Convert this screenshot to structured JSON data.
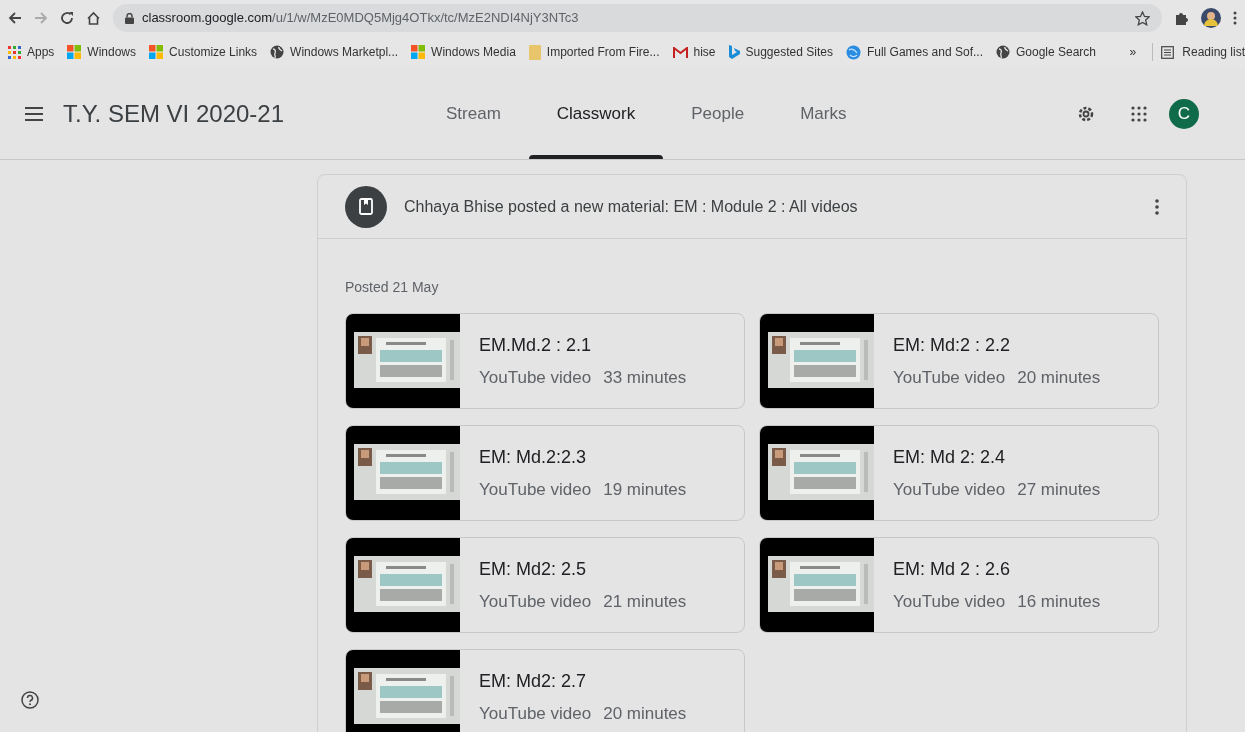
{
  "browser": {
    "url_host": "classroom.google.com",
    "url_path": "/u/1/w/MzE0MDQ5Mjg4OTkx/tc/MzE2NDI4NjY3NTc3",
    "bookmarks": [
      {
        "label": "Apps",
        "kind": "apps"
      },
      {
        "label": "Windows",
        "kind": "ms"
      },
      {
        "label": "Customize Links",
        "kind": "ms"
      },
      {
        "label": "Windows Marketpl...",
        "kind": "globe"
      },
      {
        "label": "Windows Media",
        "kind": "ms"
      },
      {
        "label": "Imported From Fire...",
        "kind": "folder"
      },
      {
        "label": "hise",
        "kind": "mail"
      },
      {
        "label": "Suggested Sites",
        "kind": "bing"
      },
      {
        "label": "Full Games and Sof...",
        "kind": "ie"
      },
      {
        "label": "Google Search",
        "kind": "globe"
      }
    ],
    "more": "»",
    "reading_list": "Reading list"
  },
  "app_bar": {
    "title": "T.Y. SEM VI 2020-21",
    "avatar": "C",
    "tabs": [
      {
        "label": "Stream",
        "selected": false
      },
      {
        "label": "Classwork",
        "selected": true
      },
      {
        "label": "People",
        "selected": false
      },
      {
        "label": "Marks",
        "selected": false
      }
    ]
  },
  "post": {
    "heading": "Chhaya Bhise posted a new material: EM : Module 2 : All videos",
    "posted": "Posted 21 May",
    "attachments": [
      {
        "title": "EM.Md.2 : 2.1",
        "type": "YouTube video",
        "duration": "33 minutes"
      },
      {
        "title": "EM: Md:2 : 2.2",
        "type": "YouTube video",
        "duration": "20 minutes"
      },
      {
        "title": "EM: Md.2:2.3",
        "type": "YouTube video",
        "duration": "19 minutes"
      },
      {
        "title": "EM: Md 2: 2.4",
        "type": "YouTube video",
        "duration": "27 minutes"
      },
      {
        "title": "EM: Md2: 2.5",
        "type": "YouTube video",
        "duration": "21 minutes"
      },
      {
        "title": "EM: Md 2 : 2.6",
        "type": "YouTube video",
        "duration": "16 minutes"
      },
      {
        "title": "EM: Md2: 2.7",
        "type": "YouTube video",
        "duration": "20 minutes"
      }
    ]
  }
}
